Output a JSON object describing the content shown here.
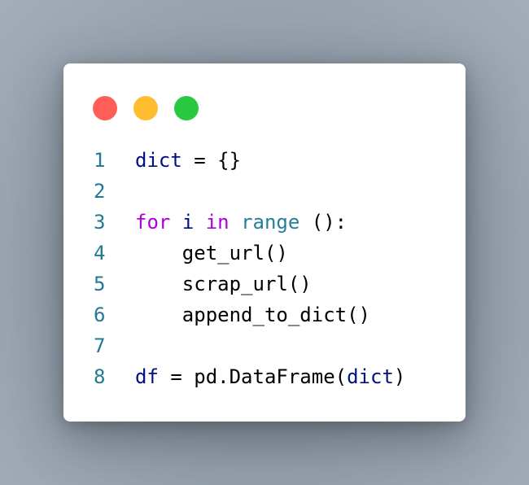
{
  "window": {
    "traffic_lights": [
      {
        "name": "close",
        "color": "#ff5f57"
      },
      {
        "name": "minimize",
        "color": "#febc2e"
      },
      {
        "name": "maximize",
        "color": "#28c840"
      }
    ]
  },
  "colors": {
    "line_number": "#237893",
    "variable": "#001080",
    "keyword": "#af00db",
    "builtin": "#267f99",
    "plain": "#000000"
  },
  "code": {
    "lines": [
      {
        "number": "1",
        "tokens": [
          {
            "text": "dict",
            "kind": "variable"
          },
          {
            "text": " = {}",
            "kind": "plain"
          }
        ]
      },
      {
        "number": "2",
        "tokens": []
      },
      {
        "number": "3",
        "tokens": [
          {
            "text": "for",
            "kind": "keyword"
          },
          {
            "text": " ",
            "kind": "plain"
          },
          {
            "text": "i",
            "kind": "variable"
          },
          {
            "text": " ",
            "kind": "plain"
          },
          {
            "text": "in",
            "kind": "keyword"
          },
          {
            "text": " ",
            "kind": "plain"
          },
          {
            "text": "range",
            "kind": "builtin"
          },
          {
            "text": " ():",
            "kind": "plain"
          }
        ]
      },
      {
        "number": "4",
        "tokens": [
          {
            "text": "    get_url()",
            "kind": "plain"
          }
        ]
      },
      {
        "number": "5",
        "tokens": [
          {
            "text": "    scrap_url()",
            "kind": "plain"
          }
        ]
      },
      {
        "number": "6",
        "tokens": [
          {
            "text": "    append_to_dict()",
            "kind": "plain"
          }
        ]
      },
      {
        "number": "7",
        "tokens": []
      },
      {
        "number": "8",
        "tokens": [
          {
            "text": "df",
            "kind": "variable"
          },
          {
            "text": " = pd.DataFrame(",
            "kind": "plain"
          },
          {
            "text": "dict",
            "kind": "variable"
          },
          {
            "text": ")",
            "kind": "plain"
          }
        ]
      }
    ]
  }
}
